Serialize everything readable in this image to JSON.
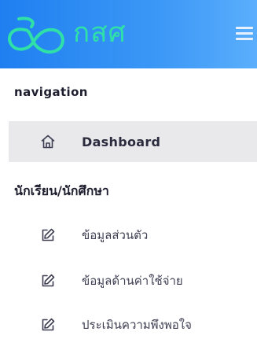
{
  "header": {
    "brand_text": "กสศ",
    "logo_icon": "loop-logo-icon",
    "menu_icon": "hamburger-menu-icon",
    "brand_color": "#2fe0a8",
    "background_color": "#2f8cf3"
  },
  "navigation": {
    "section_label": "navigation",
    "items": [
      {
        "label": "Dashboard",
        "icon": "home-icon",
        "active": true
      }
    ]
  },
  "student": {
    "section_label": "นักเรียน/นักศึกษา",
    "items": [
      {
        "label": "ข้อมูลส่วนตัว",
        "icon": "edit-icon"
      },
      {
        "label": "ข้อมูลด้านค่าใช้จ่าย",
        "icon": "edit-icon"
      },
      {
        "label": "ประเมินความพึงพอใจ",
        "icon": "edit-icon"
      }
    ]
  }
}
